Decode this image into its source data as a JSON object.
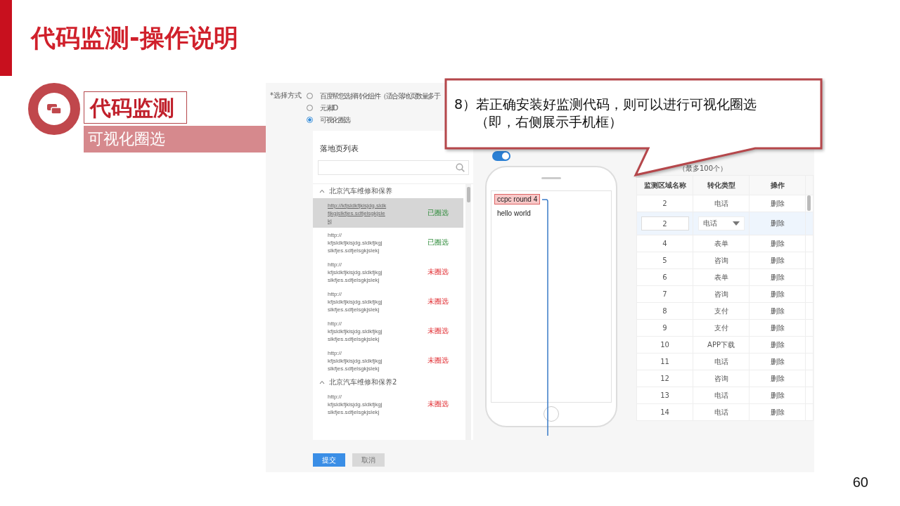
{
  "slide": {
    "title": "代码监测-操作说明",
    "section_title": "代码监测",
    "section_subtitle": "可视化圈选",
    "page_number": "60"
  },
  "callout": {
    "lines": [
      "8）若正确安装好监测代码，则可以进行可视化圈选",
      "（即，右侧展示手机框）"
    ]
  },
  "form": {
    "label": "*选择方式",
    "options": [
      {
        "label": "百度帮您选择转化组件（适合落地页数量多于",
        "selected": false
      },
      {
        "label": "元素ID",
        "selected": false
      },
      {
        "label": "可视化圈选",
        "selected": true
      }
    ]
  },
  "landing_pages": {
    "title": "落地页列表",
    "groups": [
      {
        "name": "北京汽车维修和保养",
        "expanded": true,
        "items": [
          {
            "url_lines": [
              "http://kfjsldkfjkisjdg.sldk",
              "fjkgjslkfjes.sdfjelsgkjsle",
              "kj"
            ],
            "status": "已圈选",
            "kind": "done",
            "selected": true
          },
          {
            "url_lines": [
              "http://",
              "kfjsldkfjkisjdg.sldkfjkgj",
              "slkfjes.sdfjelsgkjslekj"
            ],
            "status": "已圈选",
            "kind": "done",
            "selected": false
          },
          {
            "url_lines": [
              "http://",
              "kfjsldkfjkisjdg.sldkfjkgj",
              "slkfjes.sdfjelsgkjslekj"
            ],
            "status": "未圈选",
            "kind": "pending",
            "selected": false
          },
          {
            "url_lines": [
              "http://",
              "kfjsldkfjkisjdg.sldkfjkgj",
              "slkfjes.sdfjelsgkjslekj"
            ],
            "status": "未圈选",
            "kind": "pending",
            "selected": false
          },
          {
            "url_lines": [
              "http://",
              "kfjsldkfjkisjdg.sldkfjkgj",
              "slkfjes.sdfjelsgkjslekj"
            ],
            "status": "未圈选",
            "kind": "pending",
            "selected": false
          },
          {
            "url_lines": [
              "http://",
              "kfjsldkfjkisjdg.sldkfjkgj",
              "slkfjes.sdfjelsgkjslekj"
            ],
            "status": "未圈选",
            "kind": "pending",
            "selected": false
          }
        ]
      },
      {
        "name": "北京汽车维修和保养2",
        "expanded": true,
        "items": [
          {
            "url_lines": [
              "http://",
              "kfjsldkfjkisjdg.sldkfjkgj",
              "slkfjes.sdfjelsgkjslekj"
            ],
            "status": "未圈选",
            "kind": "pending",
            "selected": false
          }
        ]
      }
    ]
  },
  "toggle": {
    "on": true
  },
  "phone": {
    "elements": [
      {
        "text": "ccpc round 4",
        "selected": true
      },
      {
        "text": "hello world",
        "selected": false
      }
    ]
  },
  "regions": {
    "note": "（最多100个）",
    "columns": [
      "监测区域名称",
      "转化类型",
      "操作"
    ],
    "rows": [
      {
        "kind": "view",
        "name": "2",
        "type": "电话",
        "action": "删除",
        "selected": false
      },
      {
        "kind": "edit",
        "name": "2",
        "type": "电话",
        "action": "删除",
        "selected": true
      },
      {
        "kind": "view",
        "name": "4",
        "type": "表单",
        "action": "删除",
        "selected": false
      },
      {
        "kind": "view",
        "name": "5",
        "type": "咨询",
        "action": "删除",
        "selected": false
      },
      {
        "kind": "view",
        "name": "6",
        "type": "表单",
        "action": "删除",
        "selected": false
      },
      {
        "kind": "view",
        "name": "7",
        "type": "咨询",
        "action": "删除",
        "selected": false
      },
      {
        "kind": "view",
        "name": "8",
        "type": "支付",
        "action": "删除",
        "selected": false
      },
      {
        "kind": "view",
        "name": "9",
        "type": "支付",
        "action": "删除",
        "selected": false
      },
      {
        "kind": "view",
        "name": "10",
        "type": "APP下载",
        "action": "删除",
        "selected": false
      },
      {
        "kind": "view",
        "name": "11",
        "type": "电话",
        "action": "删除",
        "selected": false
      },
      {
        "kind": "view",
        "name": "12",
        "type": "咨询",
        "action": "删除",
        "selected": false
      },
      {
        "kind": "view",
        "name": "13",
        "type": "电话",
        "action": "删除",
        "selected": false
      },
      {
        "kind": "view",
        "name": "14",
        "type": "电话",
        "action": "删除",
        "selected": false
      }
    ]
  },
  "buttons": [
    {
      "label": "提交",
      "kind": "primary"
    },
    {
      "label": "取消",
      "kind": "secondary"
    }
  ]
}
